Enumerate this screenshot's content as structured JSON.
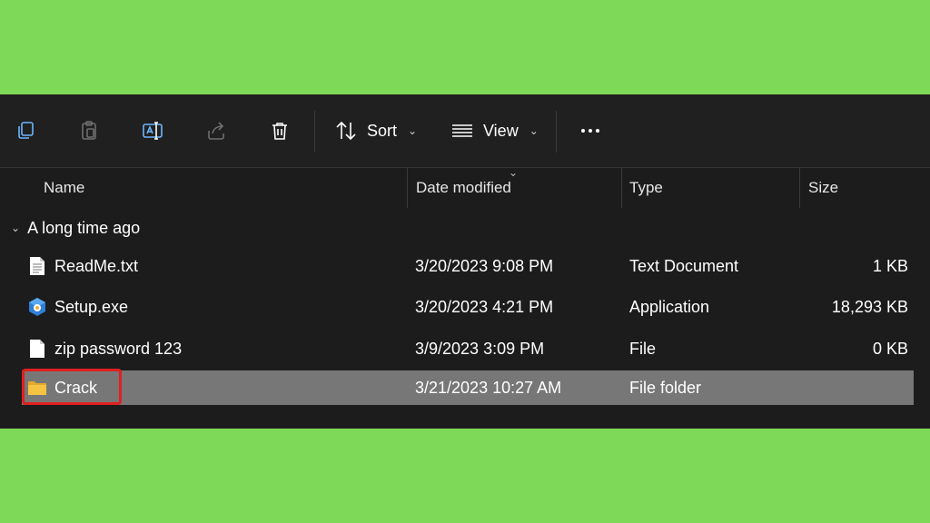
{
  "toolbar": {
    "buttons": [
      {
        "name": "copy-icon"
      },
      {
        "name": "paste-icon"
      },
      {
        "name": "rename-icon"
      },
      {
        "name": "share-icon"
      },
      {
        "name": "delete-icon"
      }
    ],
    "sort_label": "Sort",
    "view_label": "View",
    "more_icon": "ellipsis-icon"
  },
  "columns": {
    "name": "Name",
    "date": "Date modified",
    "type": "Type",
    "size": "Size"
  },
  "group": {
    "label": "A long time ago"
  },
  "files": [
    {
      "name": "ReadMe.txt",
      "date": "3/20/2023 9:08 PM",
      "type": "Text Document",
      "size": "1 KB",
      "icon": "text-document-icon"
    },
    {
      "name": "Setup.exe",
      "date": "3/20/2023 4:21 PM",
      "type": "Application",
      "size": "18,293 KB",
      "icon": "setup-app-icon"
    },
    {
      "name": "zip password 123",
      "date": "3/9/2023 3:09 PM",
      "type": "File",
      "size": "0 KB",
      "icon": "blank-file-icon"
    },
    {
      "name": "Crack",
      "date": "3/21/2023 10:27 AM",
      "type": "File folder",
      "size": "",
      "icon": "folder-icon",
      "selected": true
    }
  ],
  "colors": {
    "background": "#7dd957",
    "window": "#1c1c1c",
    "selection": "#777777",
    "highlight_border": "#e02020",
    "folder": "#f5c242"
  }
}
